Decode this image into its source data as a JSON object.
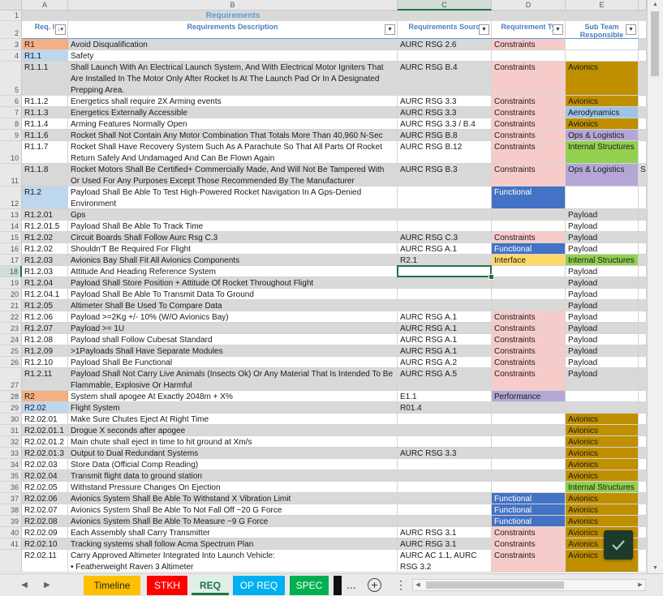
{
  "colors": {
    "orange": "#f4b183",
    "lightblue": "#bdd7ee",
    "pink": "#f8cbcb",
    "gold": "#bf8f00",
    "purple": "#b4a7d6",
    "green": "#92d050",
    "skyblue": "#9dc3e6",
    "blue": "#4472c4",
    "yellow": "#ffd966",
    "gray": "#d9d9d9",
    "white": "#ffffff",
    "accent": "#217346"
  },
  "columns": [
    "A",
    "B",
    "C",
    "D",
    "E"
  ],
  "title": "Requirements",
  "headers": {
    "a": "Req. I",
    "b": "Requirements Description",
    "c": "Requirements Sourc",
    "d": "Requirement Ty",
    "e": "Sub Team Responsible"
  },
  "rows": [
    {
      "n": "3",
      "a": "R1",
      "b": "Avoid Disqualification",
      "c": "AURC RSG 2.6",
      "d": "Constraints",
      "e": "",
      "ab": "orange",
      "rb": "gray",
      "db": "pink",
      "eb": "white"
    },
    {
      "n": "4",
      "a": "R1.1",
      "b": "Safety",
      "c": "",
      "d": "",
      "e": "",
      "ab": "lightblue",
      "rb": "white",
      "db": "white",
      "eb": "white"
    },
    {
      "n": "5",
      "a": "R1.1.1",
      "b": "Shall Launch With An Electrical Launch System, And With Electrical Motor Igniters That Are Installed In The Motor Only After Rocket Is At The Launch Pad Or In A Designated Prepping Area.",
      "c": "AURC RSG B.4",
      "d": "Constraints",
      "e": "Avionics",
      "ab": "gray",
      "rb": "gray",
      "db": "pink",
      "eb": "gold"
    },
    {
      "n": "6",
      "a": "R1.1.2",
      "b": "Energetics shall require 2X Arming events",
      "c": "AURC RSG 3.3",
      "d": "Constraints",
      "e": "Avionics",
      "ab": "white",
      "rb": "white",
      "db": "pink",
      "eb": "gold"
    },
    {
      "n": "7",
      "a": "R1.1.3",
      "b": "Energetics Externally Accessible",
      "c": "AURC RSG 3.3",
      "d": "Constraints",
      "e": "Aerodynamics",
      "ab": "gray",
      "rb": "gray",
      "db": "pink",
      "eb": "skyblue"
    },
    {
      "n": "8",
      "a": "R1.1.4",
      "b": "Arming Features Normally Open",
      "c": "AURC RSG 3.3 / B.4",
      "d": "Constraints",
      "e": "Avionics",
      "ab": "white",
      "rb": "white",
      "db": "pink",
      "eb": "gold"
    },
    {
      "n": "9",
      "a": "R1.1.6",
      "b": "Rocket Shall Not Contain Any Motor Combination  That Totals More Than 40,960 N-Sec",
      "c": "AURC RSG B.8",
      "d": "Constraints",
      "e": "Ops & Logistics",
      "ab": "gray",
      "rb": "gray",
      "db": "pink",
      "eb": "purple"
    },
    {
      "n": "10",
      "a": "R1.1.7",
      "b": "Rocket Shall Have Recovery System Such As A Parachute So That All Parts Of Rocket Return Safely And Undamaged And Can Be Flown Again",
      "c": "AURC RSG B.12",
      "d": "Constraints",
      "e": "Internal Structures",
      "ab": "white",
      "rb": "white",
      "db": "pink",
      "eb": "green"
    },
    {
      "n": "11",
      "a": "R1.1.8",
      "b": "Rocket Motors Shall Be Certified+ Commercially Made, And Will Not Be Tampered With Or Used For Any Purposes Except Those Recommended By The Manufacturer",
      "c": "AURC RSG B.3",
      "d": "Constraints",
      "e": "Ops & Logistics",
      "ab": "gray",
      "rb": "gray",
      "db": "pink",
      "eb": "purple"
    },
    {
      "n": "12",
      "a": "R1.2",
      "b": "Payload Shall Be Able To Test High-Powered Rocket Navigation In A Gps-Denied Environment",
      "c": "",
      "d": "Functional",
      "e": "",
      "ab": "lightblue",
      "rb": "white",
      "db": "blue",
      "eb": "white"
    },
    {
      "n": "13",
      "a": "R1.2.01",
      "b": "Gps",
      "c": "",
      "d": "",
      "e": "Payload",
      "ab": "gray",
      "rb": "gray",
      "db": "gray",
      "eb": "gray"
    },
    {
      "n": "14",
      "a": "R1.2.01.5",
      "b": "Payload Shall Be Able To Track Time",
      "c": "",
      "d": "",
      "e": "Payload",
      "ab": "white",
      "rb": "white",
      "db": "white",
      "eb": "white"
    },
    {
      "n": "15",
      "a": "R1.2.02",
      "b": "Circuit Boards Shall Follow Aurc Rsg C.3",
      "c": "AURC RSG C.3",
      "d": "Constraints",
      "e": "Payload",
      "ab": "gray",
      "rb": "gray",
      "db": "pink",
      "eb": "gray"
    },
    {
      "n": "16",
      "a": "R1.2.02",
      "b": "Shouldn'T Be Required For Flight",
      "c": "AURC RSG A.1",
      "d": "Functional",
      "e": "Payload",
      "ab": "white",
      "rb": "white",
      "db": "blue",
      "eb": "white"
    },
    {
      "n": "17",
      "a": "R1.2.03",
      "b": "Avionics Bay Shall Fit All Avionics Components",
      "c": "R2.1",
      "d": "Interface",
      "e": "Internal Structures",
      "ab": "gray",
      "rb": "gray",
      "db": "yellow",
      "eb": "green"
    },
    {
      "n": "18",
      "a": "R1.2.03",
      "b": "Attitude And Heading Reference System",
      "c": "",
      "d": "",
      "e": "Payload",
      "ab": "white",
      "rb": "white",
      "db": "white",
      "eb": "white"
    },
    {
      "n": "19",
      "a": "R1.2.04",
      "b": "Payload Shall Store Position + Attitude Of Rocket Throughout  Flight",
      "c": "",
      "d": "",
      "e": "Payload",
      "ab": "gray",
      "rb": "gray",
      "db": "gray",
      "eb": "gray"
    },
    {
      "n": "20",
      "a": "R1.2.04.1",
      "b": "Payload Shall Be Able To Transmit Data To Ground",
      "c": "",
      "d": "",
      "e": "Payload",
      "ab": "white",
      "rb": "white",
      "db": "white",
      "eb": "white"
    },
    {
      "n": "21",
      "a": "R1.2.05",
      "b": "Altimeter Shall Be Used To Compare Data",
      "c": "",
      "d": "",
      "e": "Payload",
      "ab": "gray",
      "rb": "gray",
      "db": "gray",
      "eb": "gray"
    },
    {
      "n": "22",
      "a": "R1.2.06",
      "b": "Payload >=2Kg +/- 10% (W/O Avionics Bay)",
      "c": "AURC RSG A.1",
      "d": "Constraints",
      "e": "Payload",
      "ab": "white",
      "rb": "white",
      "db": "pink",
      "eb": "white"
    },
    {
      "n": "23",
      "a": "R1.2.07",
      "b": "Payload >= 1U",
      "c": "AURC RSG A.1",
      "d": "Constraints",
      "e": "Payload",
      "ab": "gray",
      "rb": "gray",
      "db": "pink",
      "eb": "gray"
    },
    {
      "n": "24",
      "a": "R1.2.08",
      "b": "Payload shall Follow Cubesat Standard",
      "c": "AURC RSG A.1",
      "d": "Constraints",
      "e": "Payload",
      "ab": "white",
      "rb": "white",
      "db": "pink",
      "eb": "white"
    },
    {
      "n": "25",
      "a": "R1.2.09",
      "b": ">1Payloads Shall Have Separate Modules",
      "c": "AURC RSG A.1",
      "d": "Constraints",
      "e": "Payload",
      "ab": "gray",
      "rb": "gray",
      "db": "pink",
      "eb": "gray"
    },
    {
      "n": "26",
      "a": "R1.2.10",
      "b": "Payload Shall Be Functional",
      "c": "AURC RSG A.2",
      "d": "Constraints",
      "e": "Payload",
      "ab": "white",
      "rb": "white",
      "db": "pink",
      "eb": "white"
    },
    {
      "n": "27",
      "a": "R1.2.11",
      "b": "Payload Shall Not Carry Live Animals (Insects Ok) Or Any Material That Is Intended To Be Flammable, Explosive Or Harmful",
      "c": "AURC RSG A.5",
      "d": "Constraints",
      "e": "Payload",
      "ab": "gray",
      "rb": "gray",
      "db": "pink",
      "eb": "gray"
    },
    {
      "n": "28",
      "a": "R2",
      "b": "System shall apogee At Exactly 2048m + X%",
      "c": "E1.1",
      "d": "Performance",
      "e": "",
      "ab": "orange",
      "rb": "white",
      "db": "purple",
      "eb": "white"
    },
    {
      "n": "29",
      "a": "R2.02",
      "b": "Flight System",
      "c": "R01.4",
      "d": "",
      "e": "",
      "ab": "lightblue",
      "rb": "gray",
      "db": "gray",
      "eb": "gray"
    },
    {
      "n": "30",
      "a": "R2.02.01",
      "b": "Make Sure Chutes Eject At Right Time",
      "c": "",
      "d": "",
      "e": "Avionics",
      "ab": "white",
      "rb": "white",
      "db": "white",
      "eb": "gold"
    },
    {
      "n": "31",
      "a": "R2.02.01.1",
      "b": "Drogue X seconds after apogee",
      "c": "",
      "d": "",
      "e": "Avionics",
      "ab": "gray",
      "rb": "gray",
      "db": "gray",
      "eb": "gold"
    },
    {
      "n": "32",
      "a": "R2.02.01.2",
      "b": "Main chute shall eject in time to hit ground at Xm/s",
      "c": "",
      "d": "",
      "e": "Avionics",
      "ab": "white",
      "rb": "white",
      "db": "white",
      "eb": "gold"
    },
    {
      "n": "33",
      "a": "R2.02.01.3",
      "b": "Output to Dual Redundant Systems",
      "c": "AURC RSG 3.3",
      "d": "",
      "e": "Avionics",
      "ab": "gray",
      "rb": "gray",
      "db": "gray",
      "eb": "gold"
    },
    {
      "n": "34",
      "a": "R2.02.03",
      "b": "Store Data (Official Comp Reading)",
      "c": "",
      "d": "",
      "e": "Avionics",
      "ab": "white",
      "rb": "white",
      "db": "white",
      "eb": "gold"
    },
    {
      "n": "35",
      "a": "R2.02.04",
      "b": "Transmit flight data to ground station",
      "c": "",
      "d": "",
      "e": "Avionics",
      "ab": "gray",
      "rb": "gray",
      "db": "gray",
      "eb": "gold"
    },
    {
      "n": "36",
      "a": "R2.02.05",
      "b": "Withstand Pressure Changes On Ejection",
      "c": "",
      "d": "",
      "e": "Internal Structures",
      "ab": "white",
      "rb": "white",
      "db": "white",
      "eb": "green"
    },
    {
      "n": "37",
      "a": "R2.02.06",
      "b": "Avionics System Shall Be Able To Withstand X Vibration Limit",
      "c": "",
      "d": "Functional",
      "e": "Avionics",
      "ab": "gray",
      "rb": "gray",
      "db": "blue",
      "eb": "gold"
    },
    {
      "n": "38",
      "a": "R2.02.07",
      "b": "Avionics System Shall Be Able To Not Fall Off ~20 G Force",
      "c": "",
      "d": "Functional",
      "e": "Avionics",
      "ab": "white",
      "rb": "white",
      "db": "blue",
      "eb": "gold"
    },
    {
      "n": "39",
      "a": "R2.02.08",
      "b": "Avionics System Shall Be Able To Measure ~9 G Force",
      "c": "",
      "d": "Functional",
      "e": "Avionics",
      "ab": "gray",
      "rb": "gray",
      "db": "blue",
      "eb": "gold"
    },
    {
      "n": "40",
      "a": "R2.02.09",
      "b": "Each Assembly shall Carry Transmitter",
      "c": "AURC RSG 3.1",
      "d": "Constraints",
      "e": "Avionics",
      "ab": "white",
      "rb": "white",
      "db": "pink",
      "eb": "gold"
    },
    {
      "n": "41",
      "a": "R2.02.10",
      "b": "Tracking systems shall follow Acma Spectrum Plan",
      "c": "AURC RSG 3.1",
      "d": "Constraints",
      "e": "Avionics",
      "ab": "gray",
      "rb": "gray",
      "db": "pink",
      "eb": "gold"
    },
    {
      "n": "",
      "a": "R2.02.11",
      "b": "Carry Approved Altimeter Integrated Into Launch Vehicle:\n• Featherweight Raven 3 Altimeter",
      "c": "AURC AC 1.1, AURC RSG 3.2",
      "d": "Constraints",
      "e": "Avionics",
      "ab": "white",
      "rb": "white",
      "db": "pink",
      "eb": "gold"
    }
  ],
  "sheet_tabs": [
    {
      "label": "Timeline",
      "bg": "#ffc000",
      "fg": "#222222"
    },
    {
      "label": "STKH",
      "bg": "#ff0000",
      "fg": "#ffffff"
    },
    {
      "label": "REQ",
      "bg": "#dff0e6",
      "fg": "#217346"
    },
    {
      "label": "OP REQ",
      "bg": "#00b0f0",
      "fg": "#ffffff"
    },
    {
      "label": "SPEC",
      "bg": "#00b050",
      "fg": "#ffffff"
    },
    {
      "label": "",
      "bg": "#111111",
      "fg": "#ffffff"
    }
  ],
  "selected_cell": {
    "row": "18",
    "col": "C"
  },
  "icons": {
    "confirm": "check-icon",
    "add_sheet": "plus-circle-icon",
    "more_tabs": "ellipsis-icon",
    "more_options": "vertical-dots-icon",
    "filter": "filter-dropdown-icon"
  },
  "misc": {
    "ellipsis": "...",
    "add_symbol": "+",
    "dots": "⋮",
    "clipped_e_text": "S"
  }
}
